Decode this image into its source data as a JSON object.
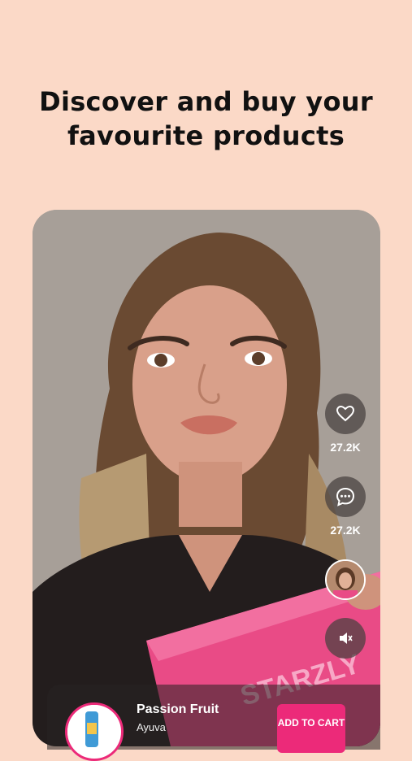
{
  "headline": {
    "line1": "Discover and buy your",
    "line2": "favourite products"
  },
  "actions": {
    "like_count": "27.2K",
    "comment_count": "27.2K",
    "like_icon": "heart-icon",
    "comment_icon": "comment-icon",
    "sound_icon": "speaker-muted-icon"
  },
  "product": {
    "title": "Passion Fruit",
    "brand": "Ayuva",
    "cta": "ADD TO CART"
  },
  "colors": {
    "background": "#fbd9c7",
    "accent": "#ec2a79",
    "box": "#e94b86"
  }
}
